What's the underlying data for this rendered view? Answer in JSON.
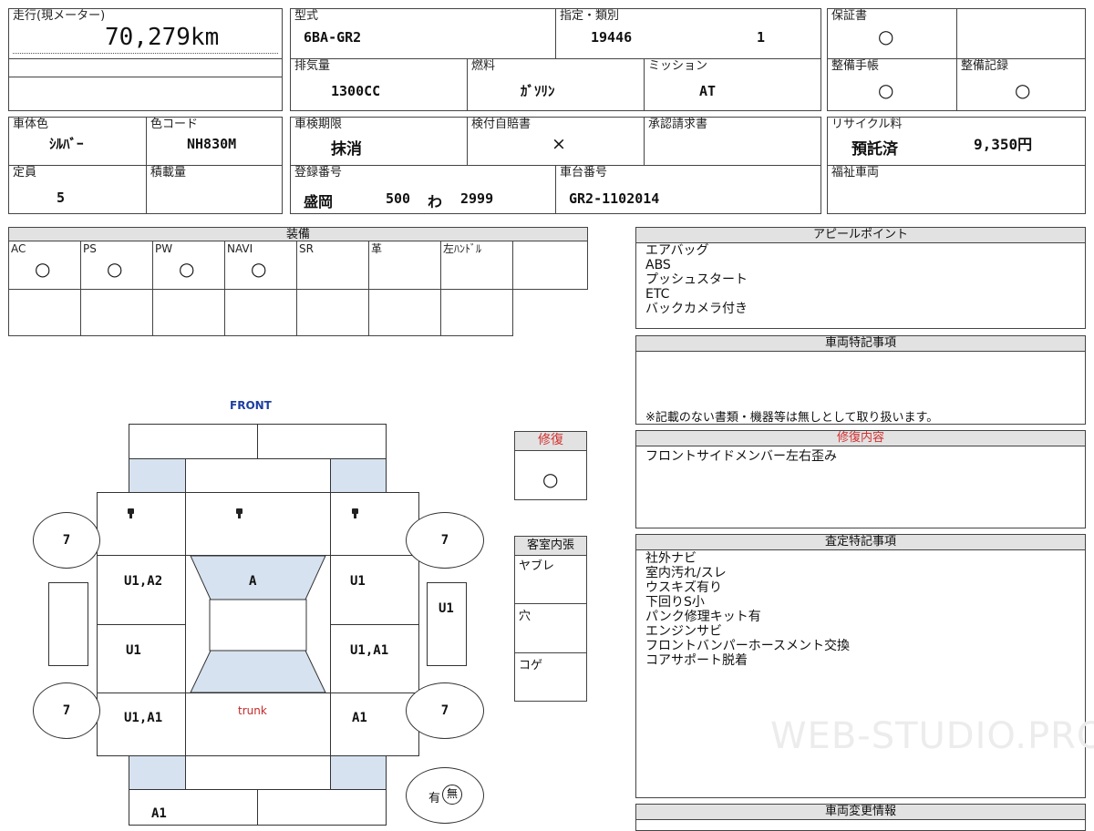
{
  "mileage": {
    "label": "走行(現メーター)",
    "value": "70,279km"
  },
  "model": {
    "label": "型式",
    "value": "6BA-GR2"
  },
  "designation": {
    "label": "指定・類別",
    "value_a": "19446",
    "value_b": "1"
  },
  "warranty": {
    "label": "保証書",
    "mark": "○"
  },
  "displacement": {
    "label": "排気量",
    "value": "1300CC"
  },
  "fuel": {
    "label": "燃料",
    "value": "ｶﾞｿﾘﾝ"
  },
  "mission": {
    "label": "ミッション",
    "value": "AT"
  },
  "service_manual": {
    "label": "整備手帳",
    "mark": "○"
  },
  "service_record": {
    "label": "整備記録",
    "mark": "○"
  },
  "body_color": {
    "label": "車体色",
    "value": "ｼﾙﾊﾞｰ"
  },
  "color_code": {
    "label": "色コード",
    "value": "NH830M"
  },
  "inspection_expiry": {
    "label": "車検期限",
    "value": "抹消"
  },
  "insurance": {
    "label": "検付自賠書",
    "value": "×"
  },
  "approval_request": {
    "label": "承認請求書"
  },
  "recycle": {
    "label": "リサイクル料",
    "status": "預託済",
    "amount": "9,350円"
  },
  "capacity": {
    "label": "定員",
    "value": "5"
  },
  "load_capacity": {
    "label": "積載量"
  },
  "registration": {
    "label": "登録番号",
    "place": "盛岡",
    "class": "500",
    "kana": "わ",
    "number": "2999"
  },
  "chassis": {
    "label": "車台番号",
    "value": "GR2-1102014"
  },
  "welfare": {
    "label": "福祉車両"
  },
  "equipment": {
    "title": "装備",
    "items": [
      {
        "label": "AC",
        "mark": "○"
      },
      {
        "label": "PS",
        "mark": "○"
      },
      {
        "label": "PW",
        "mark": "○"
      },
      {
        "label": "NAVI",
        "mark": "○"
      },
      {
        "label": "SR",
        "mark": ""
      },
      {
        "label": "革",
        "mark": ""
      },
      {
        "label": "左ﾊﾝﾄﾞﾙ",
        "mark": ""
      }
    ]
  },
  "appeal": {
    "title": "アピールポイント",
    "lines": "エアバッグ\nABS\nプッシュスタート\nETC\nバックカメラ付き"
  },
  "special_notes": {
    "title": "車両特記事項",
    "footnote": "※記載のない書類・機器等は無しとして取り扱います。"
  },
  "repair_history": {
    "title": "修復内容",
    "text": "フロントサイドメンバー左右歪み"
  },
  "appraisal": {
    "title": "査定特記事項",
    "lines": "社外ナビ\n室内汚れ/スレ\nウスキズ有り\n下回りS小\nパンク修理キット有\nエンジンサビ\nフロントバンパーホースメント交換\nコアサポート脱着"
  },
  "vehicle_change": {
    "title": "車両変更情報"
  },
  "repair_box": {
    "title": "修復",
    "mark": "○"
  },
  "interior": {
    "title": "客室内張",
    "items": [
      "ヤブレ",
      "穴",
      "コゲ"
    ]
  },
  "diagram": {
    "front_label": "FRONT",
    "trunk_label": "trunk",
    "wheel_fl": "7",
    "wheel_fr": "7",
    "wheel_rl": "7",
    "wheel_rr": "7",
    "left_front_door": "U1,A2",
    "hood": "A",
    "right_front_door": "U1",
    "left_rear_door": "U1",
    "right_rear_door": "U1,A1",
    "left_rear_fender": "U1,A1",
    "right_rear_fender": "A1",
    "right_mirror_side": "U1",
    "rear_bumper": "A1",
    "spare_yes": "有",
    "spare_no": "無"
  },
  "watermark": "WEB-STUDIO.PRO",
  "colors": {
    "front_label": "#1d3ea0",
    "trunk_label": "#c62828",
    "repair_title": "#d32f2f",
    "panel_fill": "#d6e2ef"
  }
}
